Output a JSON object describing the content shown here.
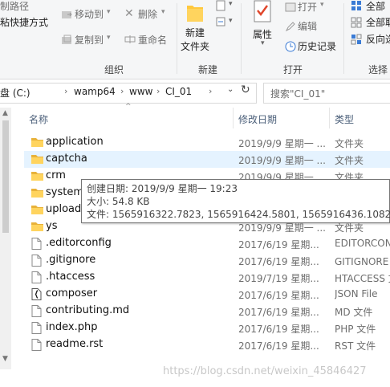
{
  "ribbon": {
    "copy_path": "制路径",
    "paste_shortcut": "粘快捷方式",
    "move_to": "移动到",
    "delete": "删除",
    "copy_to": "复制到",
    "rename": "重命名",
    "organize": "组织",
    "new_folder_line1": "新建",
    "new_folder_line2": "文件夹",
    "new_group": "新建",
    "properties": "属性",
    "open": "打开",
    "edit": "编辑",
    "history": "历史记录",
    "open_group": "打开",
    "select_all": "全部",
    "select_none": "全部取",
    "invert": "反向选",
    "select_group": "选择"
  },
  "address": {
    "crumbs": [
      "盘 (C:)",
      "wamp64",
      "www",
      "CI_01"
    ],
    "search_placeholder": "搜索\"CI_01\""
  },
  "columns": {
    "name": "名称",
    "modified": "修改日期",
    "type": "类型"
  },
  "files": [
    {
      "name": "application",
      "date": "2019/9/9 星期一 ...",
      "type": "文件夹",
      "icon": "folder-icon"
    },
    {
      "name": "captcha",
      "date": "2019/9/9 星期一 ...",
      "type": "文件夹",
      "icon": "folder-icon"
    },
    {
      "name": "crm",
      "date": "2019/9/9 星期一 ...",
      "type": "文件夹",
      "icon": "folder-icon"
    },
    {
      "name": "system",
      "date": "",
      "type": "",
      "icon": "folder-icon"
    },
    {
      "name": "upload",
      "date": "",
      "type": "",
      "icon": "folder-icon"
    },
    {
      "name": "ys",
      "date": "2019/9/9 星期一 ...",
      "type": "文件夹",
      "icon": "folder-icon"
    },
    {
      "name": ".editorconfig",
      "date": "2017/6/19 星期...",
      "type": "EDITORCONFIG",
      "icon": "file-icon"
    },
    {
      "name": ".gitignore",
      "date": "2017/6/19 星期...",
      "type": "GITIGNORE 文件",
      "icon": "file-icon"
    },
    {
      "name": ".htaccess",
      "date": "2019/7/19 星期...",
      "type": "HTACCESS 文件",
      "icon": "file-icon"
    },
    {
      "name": "composer",
      "date": "2017/6/19 星期...",
      "type": "JSON File",
      "icon": "json-file-icon"
    },
    {
      "name": "contributing.md",
      "date": "2017/6/19 星期...",
      "type": "MD 文件",
      "icon": "file-icon"
    },
    {
      "name": "index.php",
      "date": "2017/6/19 星期...",
      "type": "PHP 文件",
      "icon": "file-icon"
    },
    {
      "name": "readme.rst",
      "date": "2017/6/19 星期...",
      "type": "RST 文件",
      "icon": "file-icon"
    }
  ],
  "tooltip": {
    "created": "创建日期: 2019/9/9 星期一 19:23",
    "size": "大小: 54.8 KB",
    "files": "文件: 1565916322.7823, 1565916424.5801, 1565916436.1082, ..."
  },
  "watermark": "https://blog.csdn.net/weixin_45846427",
  "colors": {
    "folder": "#ffd45e",
    "selection": "#e5f3ff",
    "header_text": "#4c607a"
  }
}
